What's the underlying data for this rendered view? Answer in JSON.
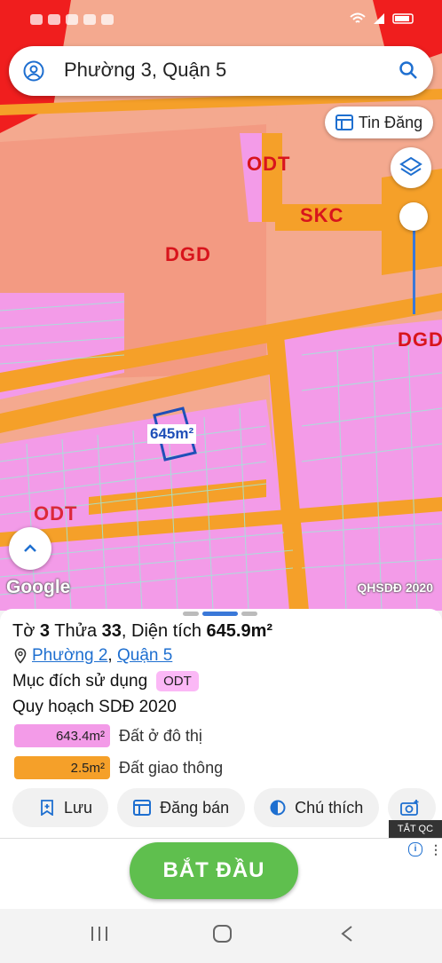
{
  "search": {
    "query": "Phường 3, Quận 5"
  },
  "map": {
    "tin_dang_label": "Tin Đăng",
    "zones": [
      "ODT",
      "SKC",
      "DGD",
      "DGD",
      "ODT"
    ],
    "parcel_area_label": "645m²",
    "google_logo": "Google",
    "attribution": "QHSDĐ 2020",
    "colors": {
      "residential": "#f39be8",
      "transport": "#f5a029",
      "education": "#f4a98f",
      "parcel_outline": "#1f4fb8"
    }
  },
  "panel": {
    "title_prefix_to": "Tờ",
    "to": "3",
    "title_prefix_thua": "Thửa",
    "thua": "33",
    "title_area_label": ", Diện tích",
    "area": "645.9m²",
    "ward": "Phường 2",
    "district": "Quận 5",
    "purpose_label": "Mục đích sử dụng",
    "purpose_code": "ODT",
    "plan_title": "Quy hoạch SDĐ 2020",
    "legend": [
      {
        "area": "643.4m²",
        "label": "Đất ở đô thị",
        "color": "#f39be8",
        "fill_fraction": 1.0
      },
      {
        "area": "2.5m²",
        "label": "Đất giao thông",
        "color": "#f5a029",
        "fill_fraction": 1.0
      }
    ],
    "actions": [
      "Lưu",
      "Đăng bán",
      "Chú thích"
    ]
  },
  "ad": {
    "tat_qc": "TẮT QC",
    "button": "BẮT ĐẦU",
    "info": "i"
  }
}
